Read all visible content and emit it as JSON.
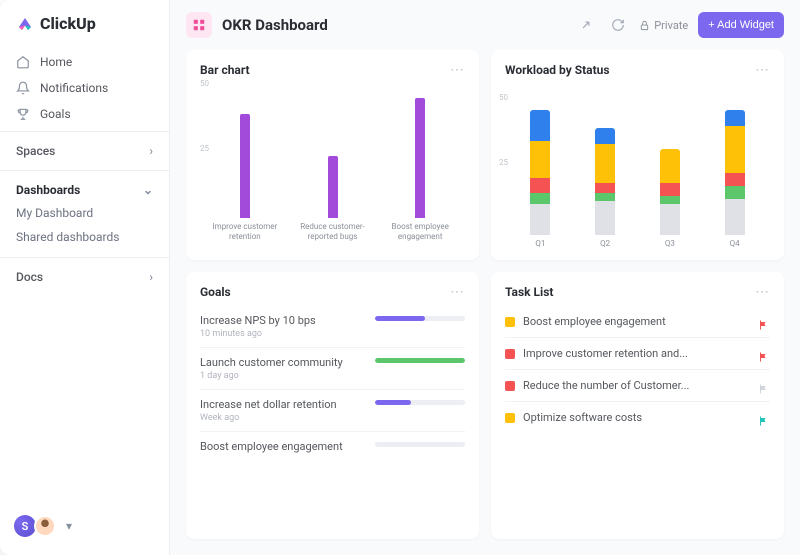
{
  "brand": {
    "name": "ClickUp"
  },
  "sidebar": {
    "nav": [
      {
        "label": "Home",
        "icon": "home-icon"
      },
      {
        "label": "Notifications",
        "icon": "bell-icon"
      },
      {
        "label": "Goals",
        "icon": "trophy-icon"
      }
    ],
    "spaces_label": "Spaces",
    "dashboards_label": "Dashboards",
    "dashboards_items": [
      {
        "label": "My Dashboard"
      },
      {
        "label": "Shared dashboards"
      }
    ],
    "docs_label": "Docs",
    "avatar_initial": "S"
  },
  "header": {
    "title": "OKR Dashboard",
    "private_label": "Private",
    "add_widget_label": "+ Add Widget"
  },
  "cards": {
    "bar_chart": {
      "title": "Bar chart"
    },
    "workload": {
      "title": "Workload by Status"
    },
    "goals": {
      "title": "Goals",
      "items": [
        {
          "name": "Increase NPS by 10 bps",
          "time": "10 minutes ago",
          "progress": 55,
          "color": "#7b68ee"
        },
        {
          "name": "Launch customer community",
          "time": "1 day ago",
          "progress": 100,
          "color": "#5cc66b"
        },
        {
          "name": "Increase net dollar retention",
          "time": "Week ago",
          "progress": 40,
          "color": "#7b68ee"
        },
        {
          "name": "Boost employee engagement",
          "time": "",
          "progress": 0,
          "color": "#7b68ee"
        }
      ]
    },
    "tasks": {
      "title": "Task List",
      "items": [
        {
          "name": "Boost employee engagement",
          "color": "#ffc107",
          "flag": "#f55353"
        },
        {
          "name": "Improve customer retention and...",
          "color": "#f55353",
          "flag": "#f55353"
        },
        {
          "name": "Reduce the number of Customer...",
          "color": "#f55353",
          "flag": "#d0d4db"
        },
        {
          "name": "Optimize software costs",
          "color": "#ffc107",
          "flag": "#20c4b8"
        }
      ]
    }
  },
  "chart_data": [
    {
      "type": "bar",
      "title": "Bar chart",
      "ylim": [
        0,
        50
      ],
      "yticks": [
        25,
        50
      ],
      "categories": [
        "Improve customer retention",
        "Reduce customer-reported bugs",
        "Boost employee engagement"
      ],
      "values": [
        40,
        24,
        46
      ],
      "color": "#a24bdb"
    },
    {
      "type": "bar_stacked",
      "title": "Workload by Status",
      "ylim": [
        0,
        50
      ],
      "yticks": [
        25,
        50
      ],
      "categories": [
        "Q1",
        "Q2",
        "Q3",
        "Q4"
      ],
      "series": [
        {
          "name": "grey",
          "color": "#dfe1e6",
          "values": [
            12,
            13,
            12,
            14
          ]
        },
        {
          "name": "green",
          "color": "#5cc66b",
          "values": [
            4,
            3,
            3,
            5
          ]
        },
        {
          "name": "red",
          "color": "#f55353",
          "values": [
            6,
            4,
            5,
            5
          ]
        },
        {
          "name": "yellow",
          "color": "#ffc107",
          "values": [
            14,
            15,
            13,
            18
          ]
        },
        {
          "name": "blue",
          "color": "#2f80ed",
          "values": [
            12,
            6,
            0,
            6
          ]
        }
      ]
    }
  ]
}
